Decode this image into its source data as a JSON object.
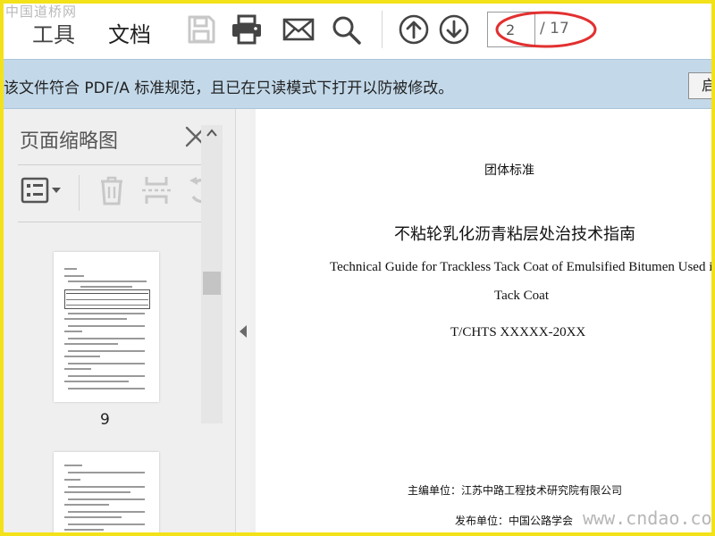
{
  "watermark": {
    "top": "中国道桥网",
    "bottom": "www.cndao.com"
  },
  "toolbar": {
    "tabs": [
      {
        "label": "工具"
      },
      {
        "label": "文档"
      }
    ],
    "icons": [
      "save-icon",
      "print-icon",
      "mail-icon",
      "search-icon",
      "arrow-up-icon",
      "arrow-down-icon"
    ],
    "page": {
      "current": "2",
      "total": "/ 17"
    }
  },
  "banner": {
    "text": "该文件符合 PDF/A 标准规范，且已在只读模式下打开以防被修改。",
    "button_label": "启用编辑"
  },
  "thumbnails": {
    "title": "页面缩略图",
    "pages": [
      {
        "label": "9"
      },
      {
        "label": ""
      }
    ]
  },
  "document": {
    "org": "团体标准",
    "title_cn": "不粘轮乳化沥青粘层处治技术指南",
    "title_en_line1": "Technical Guide for Trackless Tack Coat of Emulsified Bitumen Used in",
    "title_en_line2": "Tack Coat",
    "code": "T/CHTS XXXXX-20XX",
    "editor": "主编单位：江苏中路工程技术研究院有限公司",
    "publisher": "发布单位：中国公路学会"
  },
  "colors": {
    "banner": "#c3d9ea",
    "frame": "#f3e21a",
    "highlight": "#e23030"
  }
}
